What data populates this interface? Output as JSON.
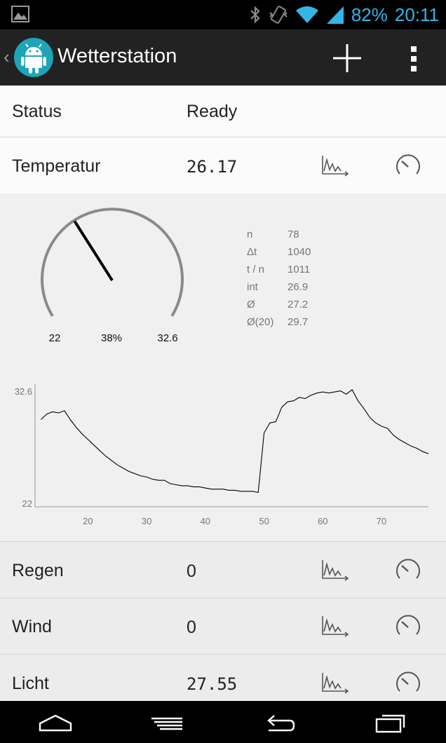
{
  "status_bar": {
    "battery_text": "82%",
    "time": "20:11",
    "accent_color": "#33b5e5"
  },
  "action_bar": {
    "title": "Wetterstation",
    "back_glyph": "‹",
    "add_icon": "plus-icon",
    "menu_icon": "overflow-menu-icon"
  },
  "rows": {
    "status": {
      "label": "Status",
      "value": "Ready"
    },
    "temperatur": {
      "label": "Temperatur",
      "value": "26.17"
    },
    "regen": {
      "label": "Regen",
      "value": "0"
    },
    "wind": {
      "label": "Wind",
      "value": "0"
    },
    "licht": {
      "label": "Licht",
      "value": "27.55"
    }
  },
  "gauge": {
    "min_label": "22",
    "max_label": "32.6",
    "percent_label": "38%",
    "fraction": 0.38
  },
  "stats": [
    {
      "key": "n",
      "value": "78"
    },
    {
      "key": "Δt",
      "value": "1040"
    },
    {
      "key": "t / n",
      "value": "1011"
    },
    {
      "key": "int",
      "value": "26.9"
    },
    {
      "key": "Ø",
      "value": "27.2"
    },
    {
      "key": "Ø(20)",
      "value": "29.7"
    }
  ],
  "chart_data": {
    "type": "line",
    "title": "",
    "xlabel": "",
    "ylabel": "",
    "ylim": [
      22,
      32.6
    ],
    "xlim": [
      11,
      78
    ],
    "x_ticks": [
      20,
      30,
      40,
      50,
      60,
      70
    ],
    "y_tick_labels": [
      "32.6",
      "22"
    ],
    "grid": false,
    "series": [
      {
        "x": [
          12,
          13,
          14,
          15,
          16,
          17,
          18,
          19,
          20,
          21,
          22,
          23,
          24,
          25,
          26,
          27,
          28,
          29,
          30,
          31,
          32,
          33,
          34,
          35,
          36,
          37,
          38,
          39,
          40,
          41,
          42,
          43,
          44,
          45,
          46,
          47,
          48,
          49,
          50,
          51,
          52,
          53,
          54,
          55,
          56,
          57,
          58,
          59,
          60,
          61,
          62,
          63,
          64,
          65,
          66,
          67,
          68,
          69,
          70,
          71,
          72,
          73,
          74,
          75,
          76,
          77,
          78
        ],
        "y": [
          29.9,
          30.4,
          30.6,
          30.5,
          30.7,
          29.9,
          29.2,
          28.6,
          28.1,
          27.6,
          27.1,
          26.6,
          26.2,
          25.8,
          25.5,
          25.2,
          25.0,
          24.8,
          24.7,
          24.5,
          24.4,
          24.4,
          24.1,
          24.0,
          23.9,
          23.9,
          23.8,
          23.8,
          23.7,
          23.6,
          23.6,
          23.6,
          23.5,
          23.5,
          23.4,
          23.4,
          23.4,
          23.3,
          28.7,
          29.6,
          29.7,
          31.0,
          31.5,
          31.6,
          31.9,
          31.8,
          32.1,
          32.3,
          32.4,
          32.3,
          32.4,
          32.5,
          32.2,
          32.6,
          31.6,
          30.9,
          30.1,
          29.6,
          29.3,
          29.1,
          28.5,
          28.1,
          27.8,
          27.5,
          27.3,
          27.0,
          26.8
        ]
      }
    ]
  }
}
